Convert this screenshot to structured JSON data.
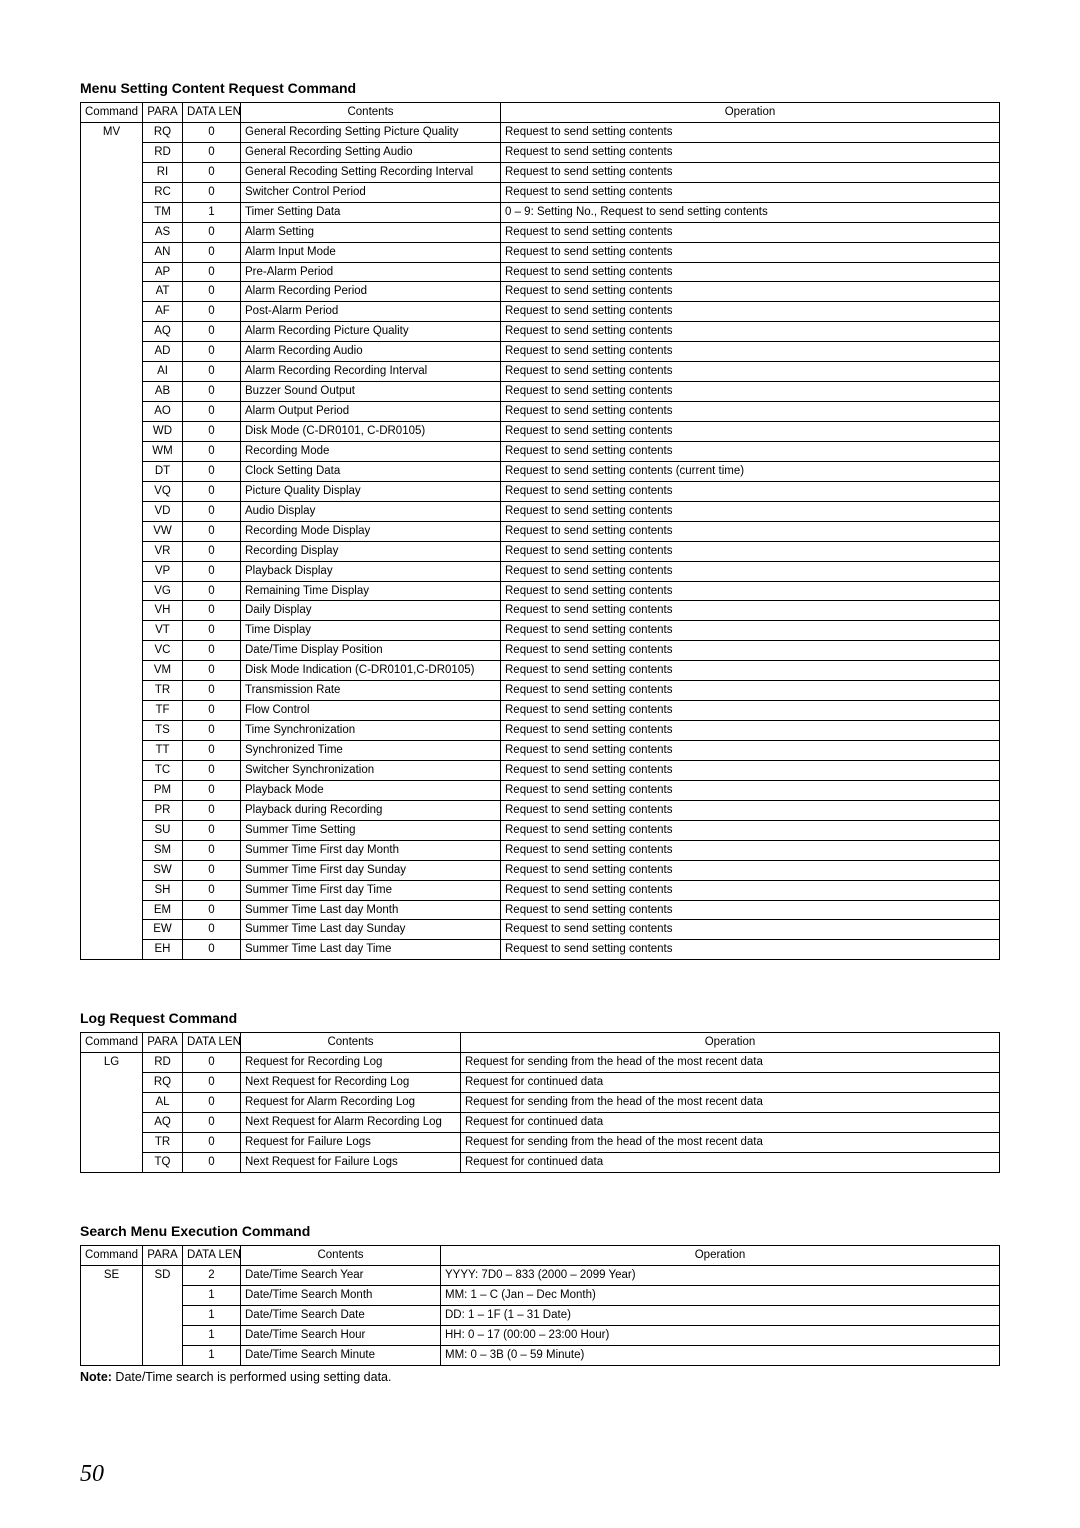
{
  "page_number": "50",
  "sections": [
    {
      "title": "Menu Setting Content Request Command",
      "columns": [
        "Command",
        "PARA",
        "DATA LEN",
        "Contents",
        "Operation"
      ],
      "command": "MV",
      "rows": [
        {
          "para": "RQ",
          "len": "0",
          "contents": "General Recording Setting Picture Quality",
          "op": "Request to send setting contents"
        },
        {
          "para": "RD",
          "len": "0",
          "contents": "General Recording Setting Audio",
          "op": "Request to send setting contents"
        },
        {
          "para": "RI",
          "len": "0",
          "contents": "General Recoding Setting Recording Interval",
          "op": "Request to send setting contents"
        },
        {
          "para": "RC",
          "len": "0",
          "contents": "Switcher Control Period",
          "op": "Request to send setting contents"
        },
        {
          "para": "TM",
          "len": "1",
          "contents": "Timer Setting Data",
          "op": "0 – 9: Setting No., Request to send setting contents"
        },
        {
          "para": "AS",
          "len": "0",
          "contents": "Alarm Setting",
          "op": "Request to send setting contents"
        },
        {
          "para": "AN",
          "len": "0",
          "contents": "Alarm Input Mode",
          "op": "Request to send setting contents"
        },
        {
          "para": "AP",
          "len": "0",
          "contents": "Pre-Alarm Period",
          "op": "Request to send setting contents"
        },
        {
          "para": "AT",
          "len": "0",
          "contents": "Alarm Recording Period",
          "op": "Request to send setting contents"
        },
        {
          "para": "AF",
          "len": "0",
          "contents": "Post-Alarm Period",
          "op": "Request to send setting contents"
        },
        {
          "para": "AQ",
          "len": "0",
          "contents": "Alarm Recording Picture Quality",
          "op": "Request to send setting contents"
        },
        {
          "para": "AD",
          "len": "0",
          "contents": "Alarm Recording Audio",
          "op": "Request to send setting contents"
        },
        {
          "para": "AI",
          "len": "0",
          "contents": "Alarm Recording Recording Interval",
          "op": "Request to send setting contents"
        },
        {
          "para": "AB",
          "len": "0",
          "contents": "Buzzer Sound Output",
          "op": "Request to send setting contents"
        },
        {
          "para": "AO",
          "len": "0",
          "contents": "Alarm Output Period",
          "op": "Request to send setting contents"
        },
        {
          "para": "WD",
          "len": "0",
          "contents": "Disk Mode (C-DR0101, C-DR0105)",
          "op": "Request to send setting contents"
        },
        {
          "para": "WM",
          "len": "0",
          "contents": "Recording Mode",
          "op": "Request to send setting contents"
        },
        {
          "para": "DT",
          "len": "0",
          "contents": "Clock Setting Data",
          "op": "Request to send setting contents (current time)"
        },
        {
          "para": "VQ",
          "len": "0",
          "contents": "Picture Quality Display",
          "op": "Request to send setting contents"
        },
        {
          "para": "VD",
          "len": "0",
          "contents": "Audio Display",
          "op": "Request to send setting contents"
        },
        {
          "para": "VW",
          "len": "0",
          "contents": "Recording Mode Display",
          "op": "Request to send setting contents"
        },
        {
          "para": "VR",
          "len": "0",
          "contents": "Recording Display",
          "op": "Request to send setting contents"
        },
        {
          "para": "VP",
          "len": "0",
          "contents": "Playback Display",
          "op": "Request to send setting contents"
        },
        {
          "para": "VG",
          "len": "0",
          "contents": "Remaining Time Display",
          "op": "Request to send setting contents"
        },
        {
          "para": "VH",
          "len": "0",
          "contents": "Daily Display",
          "op": "Request to send setting contents"
        },
        {
          "para": "VT",
          "len": "0",
          "contents": "Time Display",
          "op": "Request to send setting contents"
        },
        {
          "para": "VC",
          "len": "0",
          "contents": "Date/Time Display Position",
          "op": "Request to send setting contents"
        },
        {
          "para": "VM",
          "len": "0",
          "contents": "Disk Mode Indication (C-DR0101,C-DR0105)",
          "op": "Request to send setting contents"
        },
        {
          "para": "TR",
          "len": "0",
          "contents": "Transmission Rate",
          "op": "Request to send setting contents"
        },
        {
          "para": "TF",
          "len": "0",
          "contents": "Flow Control",
          "op": "Request to send setting contents"
        },
        {
          "para": "TS",
          "len": "0",
          "contents": "Time Synchronization",
          "op": "Request to send setting contents"
        },
        {
          "para": "TT",
          "len": "0",
          "contents": "Synchronized Time",
          "op": "Request to send setting contents"
        },
        {
          "para": "TC",
          "len": "0",
          "contents": "Switcher Synchronization",
          "op": "Request to send setting contents"
        },
        {
          "para": "PM",
          "len": "0",
          "contents": "Playback Mode",
          "op": "Request to send setting contents"
        },
        {
          "para": "PR",
          "len": "0",
          "contents": "Playback during Recording",
          "op": "Request to send setting contents"
        },
        {
          "para": "SU",
          "len": "0",
          "contents": "Summer Time Setting",
          "op": "Request to send setting contents"
        },
        {
          "para": "SM",
          "len": "0",
          "contents": "Summer Time First day Month",
          "op": "Request to send setting contents"
        },
        {
          "para": "SW",
          "len": "0",
          "contents": "Summer Time First day Sunday",
          "op": "Request to send setting contents"
        },
        {
          "para": "SH",
          "len": "0",
          "contents": "Summer Time First day Time",
          "op": "Request to send setting contents"
        },
        {
          "para": "EM",
          "len": "0",
          "contents": "Summer Time Last day Month",
          "op": "Request to send setting contents"
        },
        {
          "para": "EW",
          "len": "0",
          "contents": "Summer Time Last day Sunday",
          "op": "Request to send setting contents"
        },
        {
          "para": "EH",
          "len": "0",
          "contents": "Summer Time Last day Time",
          "op": "Request to send setting contents"
        }
      ]
    },
    {
      "title": "Log Request Command",
      "columns": [
        "Command",
        "PARA",
        "DATA LEN",
        "Contents",
        "Operation"
      ],
      "command": "LG",
      "rows": [
        {
          "para": "RD",
          "len": "0",
          "contents": "Request for Recording Log",
          "op": "Request for sending from the head of the most recent data"
        },
        {
          "para": "RQ",
          "len": "0",
          "contents": "Next Request for Recording Log",
          "op": "Request for continued data"
        },
        {
          "para": "AL",
          "len": "0",
          "contents": "Request for Alarm Recording Log",
          "op": "Request for sending from the head of the most recent data"
        },
        {
          "para": "AQ",
          "len": "0",
          "contents": "Next Request for Alarm Recording Log",
          "op": "Request for continued data"
        },
        {
          "para": "TR",
          "len": "0",
          "contents": "Request for Failure Logs",
          "op": "Request for sending from the head of the most recent data"
        },
        {
          "para": "TQ",
          "len": "0",
          "contents": "Next Request for  Failure Logs",
          "op": "Request for continued data"
        }
      ]
    },
    {
      "title": "Search Menu Execution Command",
      "columns": [
        "Command",
        "PARA",
        "DATA LEN",
        "Contents",
        "Operation"
      ],
      "command": "SE",
      "para": "SD",
      "rows": [
        {
          "len": "2",
          "contents": "Date/Time Search Year",
          "op": "YYYY: 7D0 – 833 (2000 – 2099 Year)"
        },
        {
          "len": "1",
          "contents": "Date/Time Search Month",
          "op": "MM: 1 – C (Jan – Dec Month)"
        },
        {
          "len": "1",
          "contents": "Date/Time Search Date",
          "op": "DD: 1 – 1F (1 – 31 Date)"
        },
        {
          "len": "1",
          "contents": "Date/Time Search Hour",
          "op": "HH: 0 – 17 (00:00 – 23:00 Hour)"
        },
        {
          "len": "1",
          "contents": "Date/Time Search Minute",
          "op": "MM: 0 – 3B (0 – 59 Minute)"
        }
      ],
      "note_label": "Note:",
      "note_text": " Date/Time search is performed using setting data."
    }
  ]
}
